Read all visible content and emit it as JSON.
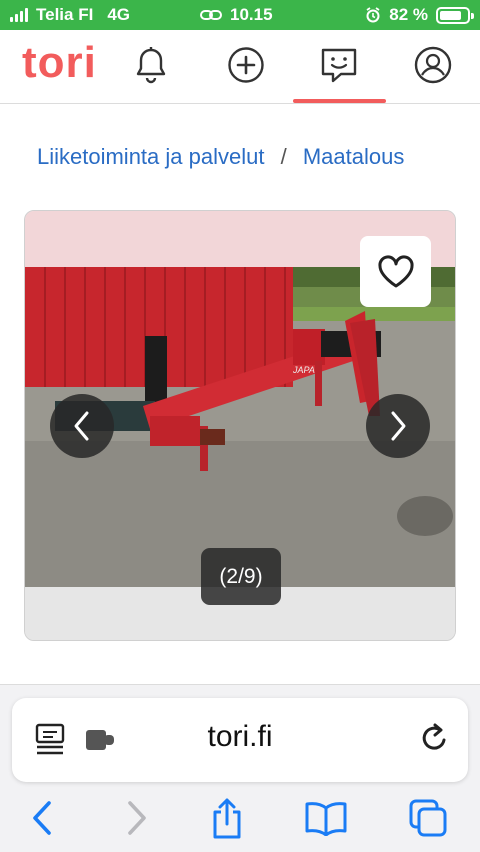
{
  "status_bar": {
    "carrier": "Telia FI",
    "network": "4G",
    "time": "10.15",
    "battery_percent": "82 %",
    "battery_level": 0.82
  },
  "nav": {
    "logo": "tori",
    "icons": [
      "bell-icon",
      "plus-circle-icon",
      "chat-icon",
      "profile-icon"
    ],
    "active": "chat-icon"
  },
  "breadcrumb": {
    "items": [
      "Liiketoiminta ja palvelut",
      "Maatalous"
    ],
    "separator": "/"
  },
  "gallery": {
    "counter": "(2/9)",
    "current": 2,
    "total": 9
  },
  "browser": {
    "url": "tori.fi"
  },
  "colors": {
    "status_bar": "#3bb54a",
    "brand": "#f25c5c",
    "link": "#2a6cc4",
    "browser_blue": "#1a7cf5"
  }
}
